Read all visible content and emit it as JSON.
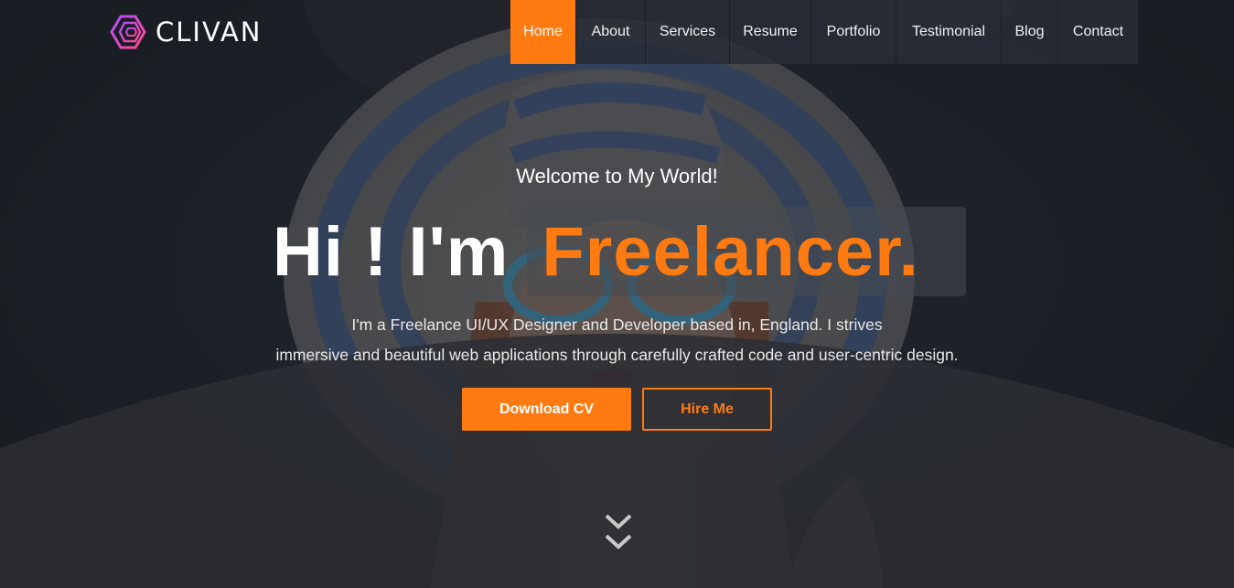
{
  "brand": {
    "name": "CLIVAN",
    "accent_color": "#ff7b12"
  },
  "nav": {
    "items": [
      {
        "label": "Home",
        "active": true
      },
      {
        "label": "About"
      },
      {
        "label": "Services"
      },
      {
        "label": "Resume"
      },
      {
        "label": "Portfolio"
      },
      {
        "label": "Testimonial"
      },
      {
        "label": "Blog"
      },
      {
        "label": "Contact"
      }
    ]
  },
  "hero": {
    "welcome": "Welcome to My World!",
    "greeting": "Hi ! I'm",
    "typed_word": "Freelancer.",
    "description_line1": "I'm a Freelance UI/UX Designer and Developer based in, England. I strives",
    "description_line2": "immersive and beautiful web applications through carefully crafted code and user-centric design.",
    "download_label": "Download CV",
    "hire_label": "Hire Me",
    "scroll_icon": "double-chevron-down-icon"
  }
}
